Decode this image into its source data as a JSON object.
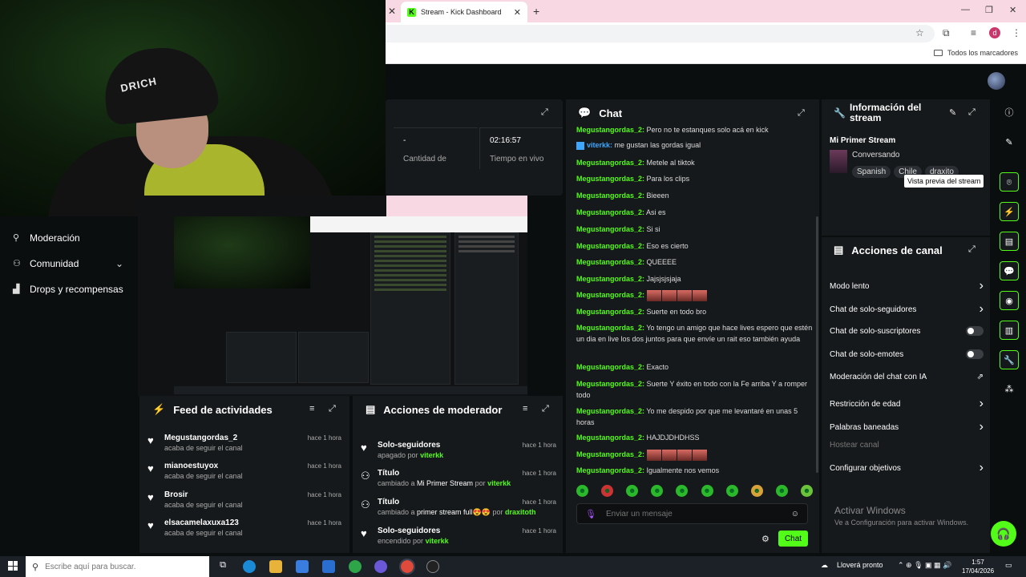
{
  "browser": {
    "tab_title": "Stream - Kick Dashboard",
    "bookmarks_label": "Todos los marcadores",
    "profile_initial": "d"
  },
  "webcam": {
    "cap_text": "DRICH"
  },
  "sidebar": {
    "items": [
      {
        "label": "Moderación"
      },
      {
        "label": "Comunidad"
      },
      {
        "label": "Drops y recompensas"
      }
    ]
  },
  "stats": {
    "stat1_value": "-",
    "stat1_label": "Cantidad de",
    "stat2_value": "02:16:57",
    "stat2_label": "Tiempo en vivo"
  },
  "chat": {
    "title": "Chat",
    "messages": [
      {
        "user": "Megustangordas_2:",
        "text": "Pero no te estanques solo acá en kick"
      },
      {
        "user": "viterkk:",
        "text": "me gustan las gordas igual"
      },
      {
        "user": "Megustangordas_2:",
        "text": "Metele al tiktok"
      },
      {
        "user": "Megustangordas_2:",
        "text": "Para los clips"
      },
      {
        "user": "Megustangordas_2:",
        "text": "Bieeen"
      },
      {
        "user": "Megustangordas_2:",
        "text": "Asi es"
      },
      {
        "user": "Megustangordas_2:",
        "text": "Si si"
      },
      {
        "user": "Megustangordas_2:",
        "text": "Eso es cierto"
      },
      {
        "user": "Megustangordas_2:",
        "text": "QUEEEE"
      },
      {
        "user": "Megustangordas_2:",
        "text": "Jajsjsjsjaja"
      },
      {
        "user": "Megustangordas_2:",
        "text": ""
      },
      {
        "user": "Megustangordas_2:",
        "text": "Suerte en todo bro"
      },
      {
        "user": "Megustangordas_2:",
        "text": "Yo tengo un amigo que hace lives espero que estén un dia en live los dos juntos para que envíe un rait eso también ayuda"
      },
      {
        "user": "Megustangordas_2:",
        "text": "Exacto"
      },
      {
        "user": "Megustangordas_2:",
        "text": "Suerte Y éxito en todo con la Fe arriba Y a romper todo"
      },
      {
        "user": "Megustangordas_2:",
        "text": "Yo me despido por que me levantaré en unas 5 horas"
      },
      {
        "user": "Megustangordas_2:",
        "text": "HAJDJDHDHSS"
      },
      {
        "user": "Megustangordas_2:",
        "text": ""
      },
      {
        "user": "Megustangordas_2:",
        "text": "Igualmente nos vemos"
      }
    ],
    "input_placeholder": "Enviar un mensaje",
    "send_label": "Chat"
  },
  "info": {
    "title": "Información del stream",
    "stream_title": "Mi Primer Stream",
    "category": "Conversando",
    "tags": [
      "Spanish",
      "Chile",
      "draxito"
    ],
    "tooltip": "Vista previa del stream"
  },
  "channel_actions": {
    "title": "Acciones de canal",
    "items": [
      {
        "label": "Modo lento",
        "control": "chevron"
      },
      {
        "label": "Chat de solo-seguidores",
        "control": "chevron"
      },
      {
        "label": "Chat de solo-suscriptores",
        "control": "toggle"
      },
      {
        "label": "Chat de solo-emotes",
        "control": "toggle"
      },
      {
        "label": "Moderación del chat con IA",
        "control": "external"
      },
      {
        "label": "Restricción de edad",
        "control": "chevron"
      },
      {
        "label": "Palabras baneadas",
        "control": "chevron"
      },
      {
        "label": "Hostear canal",
        "control": "none"
      },
      {
        "label": "Configurar objetivos",
        "control": "chevron"
      }
    ],
    "activate_title": "Activar Windows",
    "activate_sub": "Ve a Configuración para activar Windows."
  },
  "feed": {
    "title": "Feed de actividades",
    "items": [
      {
        "name": "Megustangordas_2",
        "sub": "acaba de seguir el canal",
        "time": "hace 1 hora"
      },
      {
        "name": "mianoestuyox",
        "sub": "acaba de seguir el canal",
        "time": "hace 1 hora"
      },
      {
        "name": "Brosir",
        "sub": "acaba de seguir el canal",
        "time": "hace 1 hora"
      },
      {
        "name": "elsacamelaxuxa123",
        "sub": "acaba de seguir el canal",
        "time": "hace 1 hora"
      }
    ]
  },
  "mod_actions": {
    "title": "Acciones de moderador",
    "items": [
      {
        "name": "Solo-seguidores",
        "pre": "apagado por",
        "highlight": "",
        "user": "viterkk",
        "time": "hace 1 hora",
        "icon": "heart"
      },
      {
        "name": "Título",
        "pre": "cambiado a",
        "highlight": "Mi Primer Stream",
        "user": "viterkk",
        "time": "hace 1 hora",
        "icon": "users"
      },
      {
        "name": "Título",
        "pre": "cambiado a",
        "highlight": "primer stream full😍😍",
        "user": "draxitoth",
        "time": "hace 1 hora",
        "icon": "users"
      },
      {
        "name": "Solo-seguidores",
        "pre": "encendido por",
        "highlight": "",
        "user": "viterkk",
        "time": "hace 1 hora",
        "icon": "heart"
      }
    ],
    "by_label": "por"
  },
  "taskbar": {
    "search_placeholder": "Escribe aquí para buscar.",
    "weather": "Lloverá pronto",
    "time": "1:57",
    "date": "17/04/2026"
  },
  "colors": {
    "accent": "#53fc18",
    "panel": "#16191b",
    "bg": "#0b0e0f"
  }
}
